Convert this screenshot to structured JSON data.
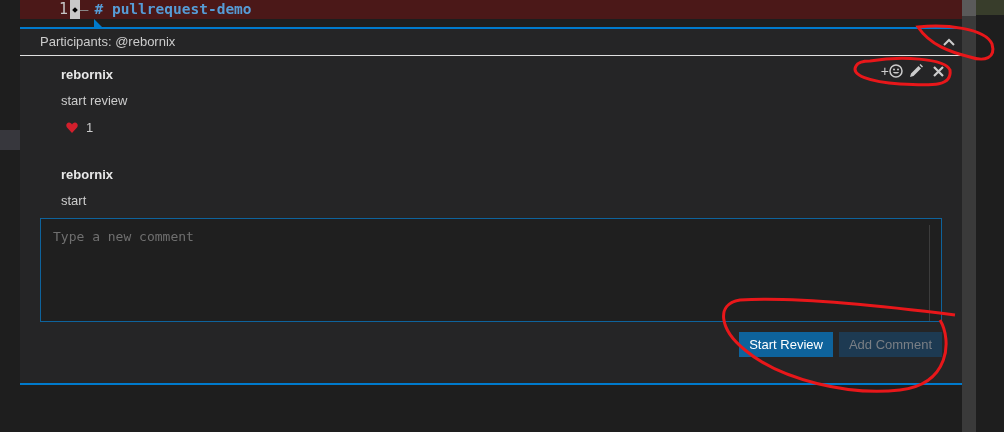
{
  "editor": {
    "line_number": "1",
    "diff_marker": "–",
    "code": "# pullrequest-demo"
  },
  "thread": {
    "participants": "Participants: @rebornix",
    "expanded": true,
    "comments": [
      {
        "author": "rebornix",
        "body": "start review",
        "reactions": [
          {
            "count": "1"
          }
        ],
        "actions_visible": true,
        "add_reaction": "+"
      },
      {
        "author": "rebornix",
        "body": "start",
        "actions_visible": false
      }
    ],
    "reply": {
      "placeholder": "Type a new comment"
    },
    "buttons": [
      {
        "label": "Start Review",
        "disabled": false
      },
      {
        "label": "Add Comment",
        "disabled": true
      }
    ]
  }
}
